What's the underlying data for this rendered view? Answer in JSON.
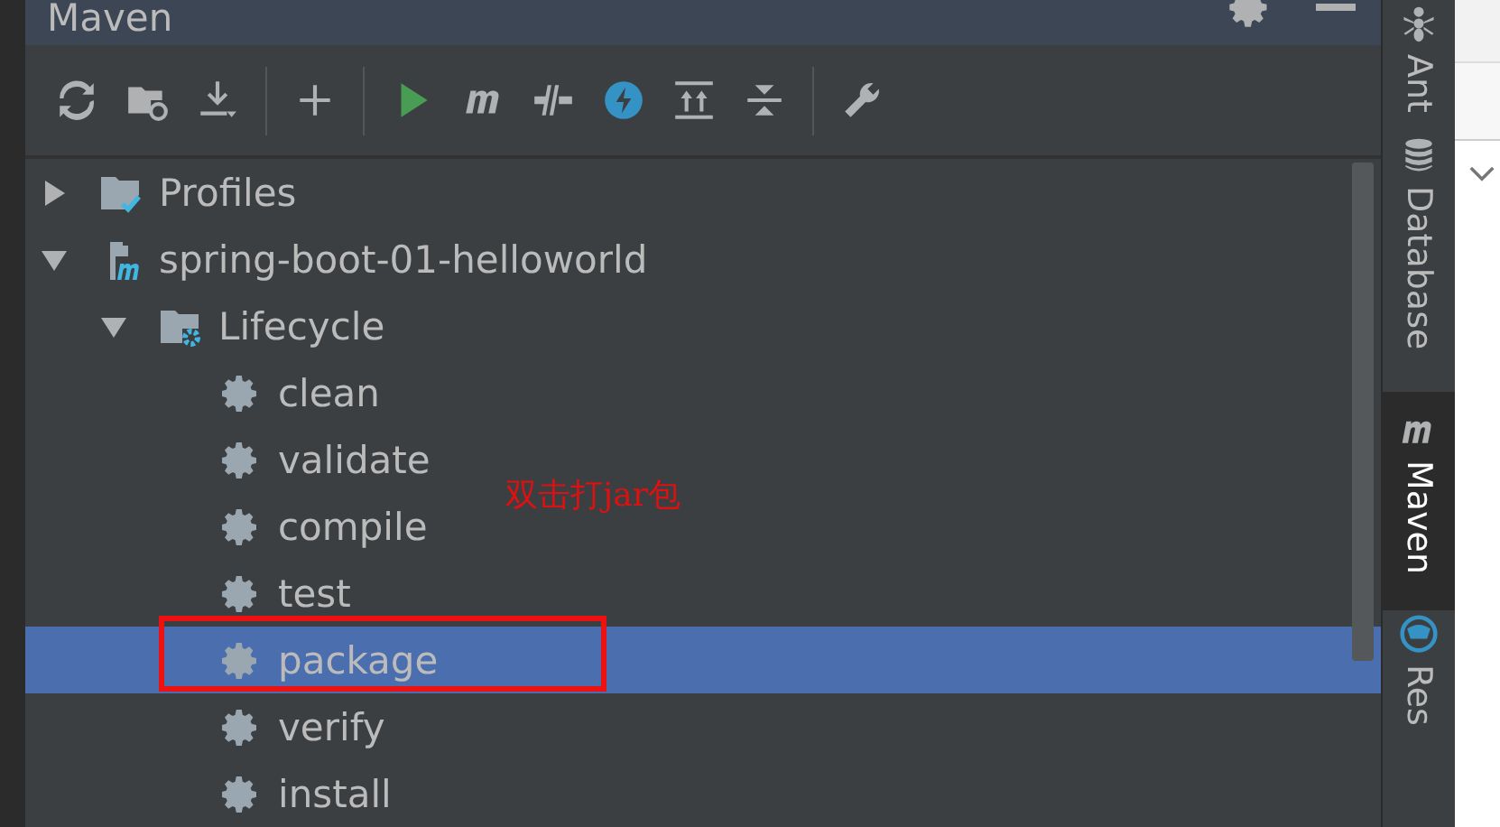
{
  "panel": {
    "title": "Maven"
  },
  "toolbar": [
    {
      "kind": "reload"
    },
    {
      "kind": "folder-sync"
    },
    {
      "kind": "download"
    },
    {
      "kind": "separator"
    },
    {
      "kind": "add"
    },
    {
      "kind": "separator"
    },
    {
      "kind": "run"
    },
    {
      "kind": "maven"
    },
    {
      "kind": "skip"
    },
    {
      "kind": "bolt"
    },
    {
      "kind": "expand"
    },
    {
      "kind": "collapse"
    },
    {
      "kind": "separator"
    },
    {
      "kind": "wrench"
    }
  ],
  "tree": [
    {
      "label": "Profiles",
      "kind": "profiles",
      "expanded": false,
      "selected": false
    },
    {
      "label": "spring-boot-01-helloworld",
      "kind": "project",
      "expanded": true,
      "selected": false,
      "children": [
        {
          "label": "Lifecycle",
          "kind": "lifecycle",
          "expanded": true,
          "selected": false,
          "children": [
            {
              "label": "clean",
              "kind": "goal",
              "selected": false
            },
            {
              "label": "validate",
              "kind": "goal",
              "selected": false
            },
            {
              "label": "compile",
              "kind": "goal",
              "selected": false
            },
            {
              "label": "test",
              "kind": "goal",
              "selected": false
            },
            {
              "label": "package",
              "kind": "goal",
              "selected": true
            },
            {
              "label": "verify",
              "kind": "goal",
              "selected": false
            },
            {
              "label": "install",
              "kind": "goal",
              "selected": false
            }
          ]
        }
      ]
    }
  ],
  "annotation": {
    "text": "双击打jar包"
  },
  "tool_strip": [
    {
      "label": "Ant",
      "kind": "ant",
      "selected": false
    },
    {
      "label": "Database",
      "kind": "database",
      "selected": false
    },
    {
      "label": "Maven",
      "kind": "maven",
      "selected": true
    },
    {
      "label": "Res",
      "kind": "globe",
      "selected": false
    }
  ]
}
